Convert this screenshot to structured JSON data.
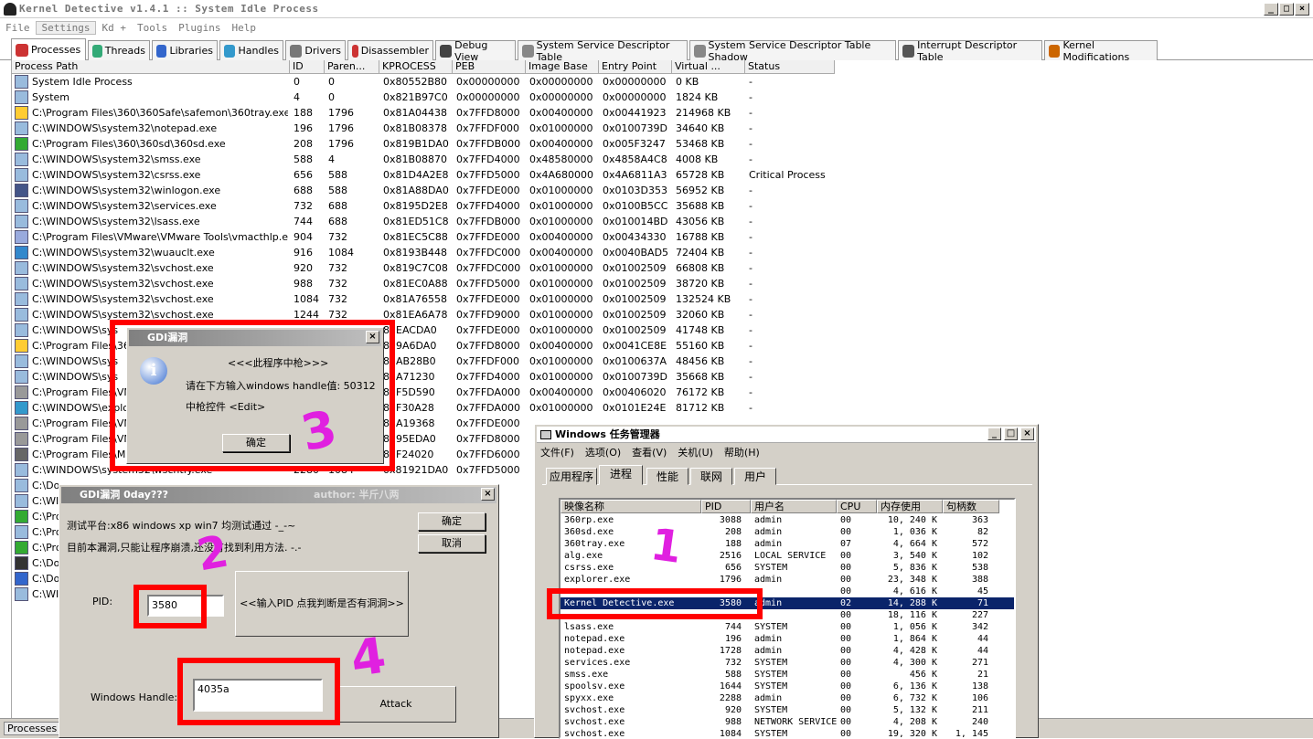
{
  "main": {
    "title": "Kernel Detective v1.4.1 :: System Idle Process",
    "menu": [
      "File",
      "Settings",
      "Kd +",
      "Tools",
      "Plugins",
      "Help"
    ],
    "tabs": [
      "Processes",
      "Threads",
      "Libraries",
      "Handles",
      "Drivers",
      "Disassembler",
      "Debug View",
      "System Service Descriptor Table",
      "System Service Descriptor Table Shadow",
      "Interrupt Descriptor Table",
      "Kernel Modifications"
    ],
    "columns": [
      "Process Path",
      "ID",
      "Paren...",
      "KPROCESS",
      "PEB",
      "Image Base",
      "Entry Point",
      "Virtual ...",
      "Status"
    ],
    "rows": [
      [
        "System Idle Process",
        "0",
        "0",
        "0x80552B80",
        "0x00000000",
        "0x00000000",
        "0x00000000",
        "0 KB",
        "-"
      ],
      [
        "System",
        "4",
        "0",
        "0x821B97C0",
        "0x00000000",
        "0x00000000",
        "0x00000000",
        "1824 KB",
        "-"
      ],
      [
        "C:\\Program Files\\360\\360Safe\\safemon\\360tray.exe",
        "188",
        "1796",
        "0x81A04438",
        "0x7FFD8000",
        "0x00400000",
        "0x00441923",
        "214968 KB",
        "-"
      ],
      [
        "C:\\WINDOWS\\system32\\notepad.exe",
        "196",
        "1796",
        "0x81B08378",
        "0x7FFDF000",
        "0x01000000",
        "0x0100739D",
        "34640 KB",
        "-"
      ],
      [
        "C:\\Program Files\\360\\360sd\\360sd.exe",
        "208",
        "1796",
        "0x819B1DA0",
        "0x7FFDB000",
        "0x00400000",
        "0x005F3247",
        "53468 KB",
        "-"
      ],
      [
        "C:\\WINDOWS\\system32\\smss.exe",
        "588",
        "4",
        "0x81B08870",
        "0x7FFD4000",
        "0x48580000",
        "0x4858A4C8",
        "4008 KB",
        "-"
      ],
      [
        "C:\\WINDOWS\\system32\\csrss.exe",
        "656",
        "588",
        "0x81D4A2E8",
        "0x7FFD5000",
        "0x4A680000",
        "0x4A6811A3",
        "65728 KB",
        "Critical Process"
      ],
      [
        "C:\\WINDOWS\\system32\\winlogon.exe",
        "688",
        "588",
        "0x81A88DA0",
        "0x7FFDE000",
        "0x01000000",
        "0x0103D353",
        "56952 KB",
        "-"
      ],
      [
        "C:\\WINDOWS\\system32\\services.exe",
        "732",
        "688",
        "0x8195D2E8",
        "0x7FFD4000",
        "0x01000000",
        "0x0100B5CC",
        "35688 KB",
        "-"
      ],
      [
        "C:\\WINDOWS\\system32\\lsass.exe",
        "744",
        "688",
        "0x81ED51C8",
        "0x7FFDB000",
        "0x01000000",
        "0x010014BD",
        "43056 KB",
        "-"
      ],
      [
        "C:\\Program Files\\VMware\\VMware Tools\\vmacthlp.exe",
        "904",
        "732",
        "0x81EC5C88",
        "0x7FFDE000",
        "0x00400000",
        "0x00434330",
        "16788 KB",
        "-"
      ],
      [
        "C:\\WINDOWS\\system32\\wuauclt.exe",
        "916",
        "1084",
        "0x8193B448",
        "0x7FFDC000",
        "0x00400000",
        "0x0040BAD5",
        "72404 KB",
        "-"
      ],
      [
        "C:\\WINDOWS\\system32\\svchost.exe",
        "920",
        "732",
        "0x819C7C08",
        "0x7FFDC000",
        "0x01000000",
        "0x01002509",
        "66808 KB",
        "-"
      ],
      [
        "C:\\WINDOWS\\system32\\svchost.exe",
        "988",
        "732",
        "0x81EC0A88",
        "0x7FFD5000",
        "0x01000000",
        "0x01002509",
        "38720 KB",
        "-"
      ],
      [
        "C:\\WINDOWS\\system32\\svchost.exe",
        "1084",
        "732",
        "0x81A76558",
        "0x7FFDE000",
        "0x01000000",
        "0x01002509",
        "132524 KB",
        "-"
      ],
      [
        "C:\\WINDOWS\\system32\\svchost.exe",
        "1244",
        "732",
        "0x81EA6A78",
        "0x7FFD9000",
        "0x01000000",
        "0x01002509",
        "32060 KB",
        "-"
      ],
      [
        "C:\\WINDOWS\\sys",
        "",
        "",
        "81EACDA0",
        "0x7FFDE000",
        "0x01000000",
        "0x01002509",
        "41748 KB",
        "-"
      ],
      [
        "C:\\Program Files\\360",
        "",
        "",
        "819A6DA0",
        "0x7FFD8000",
        "0x00400000",
        "0x0041CE8E",
        "55160 KB",
        "-"
      ],
      [
        "C:\\WINDOWS\\sys",
        "",
        "",
        "81AB28B0",
        "0x7FFDF000",
        "0x01000000",
        "0x0100637A",
        "48456 KB",
        "-"
      ],
      [
        "C:\\WINDOWS\\sys",
        "",
        "",
        "81A71230",
        "0x7FFD4000",
        "0x01000000",
        "0x0100739D",
        "35668 KB",
        "-"
      ],
      [
        "C:\\Program Files\\VMw",
        "",
        "",
        "81F5D590",
        "0x7FFDA000",
        "0x00400000",
        "0x00406020",
        "76172 KB",
        "-"
      ],
      [
        "C:\\WINDOWS\\explor",
        "",
        "",
        "81F30A28",
        "0x7FFDA000",
        "0x01000000",
        "0x0101E24E",
        "81712 KB",
        "-"
      ],
      [
        "C:\\Program Files\\VMw",
        "",
        "",
        "81A19368",
        "0x7FFDE000",
        "",
        "",
        "",
        ""
      ],
      [
        "C:\\Program Files\\VMw",
        "",
        "",
        "8195EDA0",
        "0x7FFD8000",
        "",
        "",
        "",
        ""
      ],
      [
        "C:\\Program Files\\Mi",
        "",
        "",
        "81F24020",
        "0x7FFD6000",
        "",
        "",
        "",
        ""
      ],
      [
        "C:\\WINDOWS\\system32\\wscntfy.exe",
        "2280",
        "1084",
        "0x81921DA0",
        "0x7FFD5000",
        "",
        "",
        "",
        ""
      ],
      [
        "C:\\Do",
        "",
        "",
        "",
        "",
        "",
        "",
        "",
        ""
      ],
      [
        "C:\\WI",
        "",
        "",
        "",
        "",
        "",
        "",
        "",
        ""
      ],
      [
        "C:\\Pro",
        "",
        "",
        "",
        "",
        "",
        "",
        "",
        ""
      ],
      [
        "C:\\Pro",
        "",
        "",
        "",
        "",
        "",
        "",
        "",
        ""
      ],
      [
        "C:\\Pro",
        "",
        "",
        "",
        "",
        "",
        "",
        "",
        ""
      ],
      [
        "C:\\Do",
        "",
        "",
        "",
        "",
        "",
        "",
        "",
        ""
      ],
      [
        "C:\\Do",
        "",
        "",
        "",
        "",
        "",
        "",
        "",
        ""
      ],
      [
        "C:\\WI",
        "",
        "",
        "",
        "",
        "",
        "",
        "",
        ""
      ]
    ],
    "status_tab": "Processes"
  },
  "dlg1": {
    "title": "GDI漏洞",
    "line1": "<<<此程序中枪>>>",
    "line2": "请在下方输入windows handle值: 50312",
    "line3": "中枪控件 <Edit>",
    "ok": "确定"
  },
  "dlg2": {
    "title": "GDI漏洞 0day???",
    "author": "author: 半斤八两",
    "line1": "测试平台:x86  windows xp win7 均测试通过 -_-~",
    "line2": "目前本漏洞,只能让程序崩溃,还没有找到利用方法.  -.-",
    "ok": "确定",
    "cancel": "取消",
    "pid_label": "PID:",
    "pid_value": "3580",
    "check_btn": "<<输入PID 点我判断是否有洞洞>>",
    "handle_label": "Windows Handle:",
    "handle_value": "4035a",
    "attack": "Attack"
  },
  "tm": {
    "title": "Windows 任务管理器",
    "menu": [
      "文件(F)",
      "选项(O)",
      "查看(V)",
      "关机(U)",
      "帮助(H)"
    ],
    "tabs": [
      "应用程序",
      "进程",
      "性能",
      "联网",
      "用户"
    ],
    "columns": [
      "映像名称",
      "PID",
      "用户名",
      "CPU",
      "内存使用",
      "句柄数"
    ],
    "rows": [
      [
        "360rp.exe",
        "3088",
        "admin",
        "00",
        "10, 240 K",
        "363"
      ],
      [
        "360sd.exe",
        "208",
        "admin",
        "00",
        "1, 036 K",
        "82"
      ],
      [
        "360tray.exe",
        "188",
        "admin",
        "07",
        "4, 664 K",
        "572"
      ],
      [
        "alg.exe",
        "2516",
        "LOCAL SERVICE",
        "00",
        "3, 540 K",
        "102"
      ],
      [
        "csrss.exe",
        "656",
        "SYSTEM",
        "00",
        "5, 836 K",
        "538"
      ],
      [
        "explorer.exe",
        "1796",
        "admin",
        "00",
        "23, 348 K",
        "388"
      ],
      [
        "",
        "",
        "",
        "00",
        "4, 616 K",
        "45"
      ],
      [
        "Kernel Detective.exe",
        "3580",
        "admin",
        "02",
        "14, 288 K",
        "71"
      ],
      [
        "",
        "",
        "",
        "00",
        "18, 116 K",
        "227"
      ],
      [
        "lsass.exe",
        "744",
        "SYSTEM",
        "00",
        "1, 056 K",
        "342"
      ],
      [
        "notepad.exe",
        "196",
        "admin",
        "00",
        "1, 864 K",
        "44"
      ],
      [
        "notepad.exe",
        "1728",
        "admin",
        "00",
        "4, 428 K",
        "44"
      ],
      [
        "services.exe",
        "732",
        "SYSTEM",
        "00",
        "4, 300 K",
        "271"
      ],
      [
        "smss.exe",
        "588",
        "SYSTEM",
        "00",
        "456 K",
        "21"
      ],
      [
        "spoolsv.exe",
        "1644",
        "SYSTEM",
        "00",
        "6, 136 K",
        "138"
      ],
      [
        "spyxx.exe",
        "2288",
        "admin",
        "00",
        "6, 732 K",
        "106"
      ],
      [
        "svchost.exe",
        "920",
        "SYSTEM",
        "00",
        "5, 132 K",
        "211"
      ],
      [
        "svchost.exe",
        "988",
        "NETWORK SERVICE",
        "00",
        "4, 208 K",
        "240"
      ],
      [
        "svchost.exe",
        "1084",
        "SYSTEM",
        "00",
        "19, 320 K",
        "1, 145"
      ]
    ]
  },
  "annotations": [
    "1",
    "2",
    "3",
    "4"
  ],
  "colors": {
    "highlight": "#ff0000",
    "scribble": "#e020e0",
    "selection": "#0a246a"
  }
}
